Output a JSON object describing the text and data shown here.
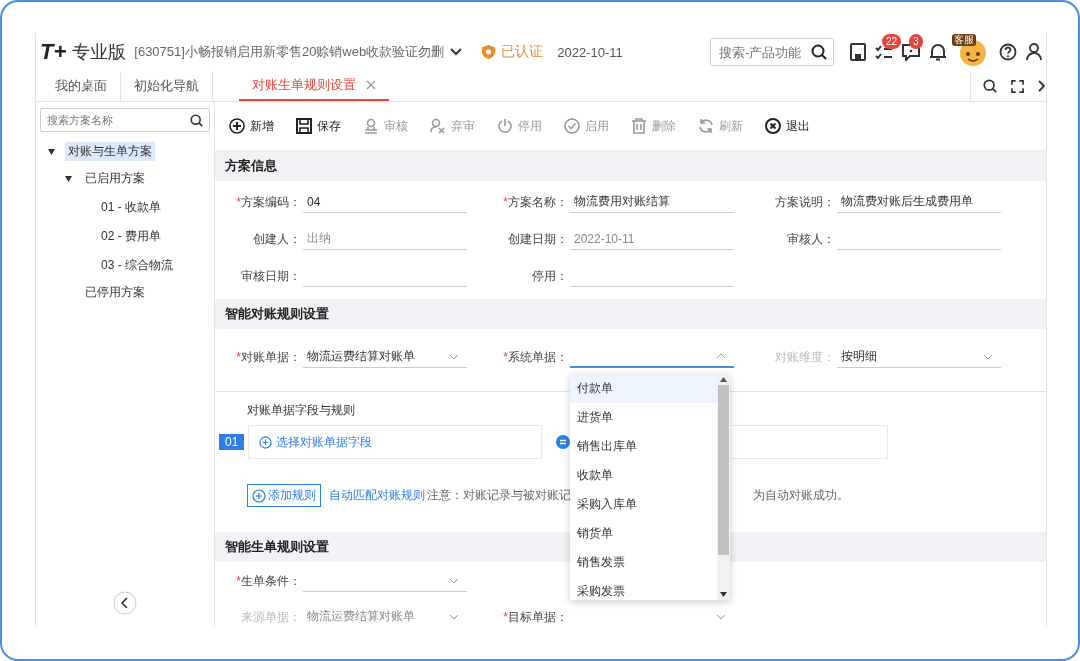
{
  "header": {
    "logo": "T+",
    "edition": "专业版",
    "company": "[630751]小畅报销启用新零售20赊销web收款验证勿删",
    "verified": "已认证",
    "date": "2022-10-11",
    "search_placeholder": "搜索-产品功能",
    "task_badge": "22",
    "message_badge": "3",
    "service_label": "客服"
  },
  "tabs": [
    {
      "label": "我的桌面",
      "selected": false,
      "closable": false
    },
    {
      "label": "初始化导航",
      "selected": false,
      "closable": false
    },
    {
      "label": "对账生单规则设置",
      "selected": true,
      "closable": true
    }
  ],
  "sidebar": {
    "search_placeholder": "搜索方案名称",
    "tree": [
      {
        "label": "对账与生单方案",
        "expanded": true,
        "selected": true,
        "children": [
          {
            "label": "已启用方案",
            "expanded": true,
            "selected": false,
            "children": [
              {
                "label": "01 - 收款单",
                "selected": false
              },
              {
                "label": "02 - 费用单",
                "selected": false
              },
              {
                "label": "03 - 综合物流",
                "selected": false
              }
            ]
          },
          {
            "label": "已停用方案",
            "selected": false
          }
        ]
      }
    ]
  },
  "toolbar": [
    {
      "kind": "add",
      "label": "新增",
      "disabled": false
    },
    {
      "kind": "save",
      "label": "保存",
      "disabled": false
    },
    {
      "kind": "audit",
      "label": "审核",
      "disabled": true
    },
    {
      "kind": "unaudit",
      "label": "弃审",
      "disabled": true
    },
    {
      "kind": "power",
      "label": "停用",
      "disabled": true
    },
    {
      "kind": "enable",
      "label": "启用",
      "disabled": true
    },
    {
      "kind": "delete",
      "label": "删除",
      "disabled": true
    },
    {
      "kind": "refresh",
      "label": "刷新",
      "disabled": true
    },
    {
      "kind": "exit",
      "label": "退出",
      "disabled": false
    }
  ],
  "scheme_info": {
    "title": "方案信息",
    "fields": [
      {
        "required_mark": "*",
        "label": "方案编码：",
        "value": "04",
        "readonly": false
      },
      {
        "required_mark": "*",
        "label": "方案名称：",
        "value": "物流费用对账结算",
        "readonly": false
      },
      {
        "label": "方案说明：",
        "value": "物流费对账后生成费用单",
        "readonly": false
      },
      {
        "label": "创建人：",
        "value": "出纳",
        "readonly": true
      },
      {
        "label": "创建日期：",
        "value": "2022-10-11",
        "readonly": true
      },
      {
        "label": "审核人："
      },
      {
        "label": "审核日期："
      },
      {
        "label": "停用："
      }
    ]
  },
  "reconcile": {
    "title": "智能对账规则设置",
    "fields": [
      {
        "required_mark": "*",
        "label": "对账单据：",
        "value": "物流运费结算对账单",
        "disabled": false,
        "open": false
      },
      {
        "required_mark": "*",
        "label": "系统单据：",
        "disabled": false,
        "open": true,
        "options": [
          {
            "label": "付款单",
            "selected": true
          },
          {
            "label": "进货单",
            "selected": false
          },
          {
            "label": "销售出库单",
            "selected": false
          },
          {
            "label": "收款单",
            "selected": false
          },
          {
            "label": "采购入库单",
            "selected": false
          },
          {
            "label": "销货单",
            "selected": false
          },
          {
            "label": "销售发票",
            "selected": false
          },
          {
            "label": "采购发票",
            "selected": false
          }
        ]
      },
      {
        "label": "对账维度：",
        "value": "按明细",
        "disabled": true,
        "open": false
      }
    ],
    "rules_title": "对账单据字段与规则",
    "rules": [
      {
        "index": "01",
        "field_link": "选择对账单据字段"
      }
    ],
    "add_rule": "添加规则",
    "auto_match": "自动匹配对账规则",
    "note_start": "注意：对账记录与被对账记",
    "note_end": "为自动对账成功。"
  },
  "generate": {
    "title": "智能生单规则设置",
    "fields": [
      {
        "required_mark": "*",
        "label": "生单条件：",
        "disabled": false
      },
      {
        "label": "来源单据：",
        "value": "物流运费结算对账单",
        "disabled": true
      },
      {
        "required_mark": "*",
        "label": "目标单据：",
        "disabled": false
      }
    ]
  }
}
